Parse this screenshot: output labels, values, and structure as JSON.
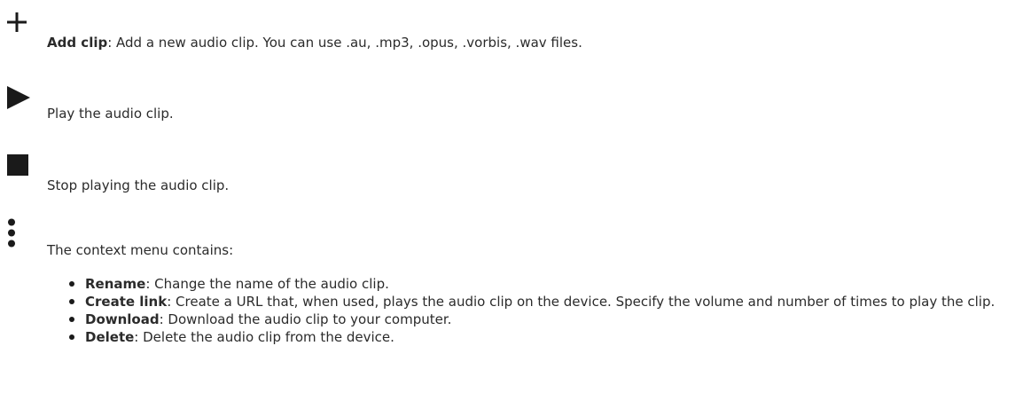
{
  "entries": [
    {
      "icon": "plus-icon",
      "term": "Add clip",
      "text": ": Add a new audio clip. You can use .au, .mp3, .opus, .vorbis, .wav files."
    },
    {
      "icon": "play-icon",
      "text": "Play the audio clip."
    },
    {
      "icon": "stop-icon",
      "text": "Stop playing the audio clip."
    },
    {
      "icon": "more-vertical-icon",
      "text": "The context menu contains:"
    }
  ],
  "context_menu": [
    {
      "term": "Rename",
      "text": ": Change the name of the audio clip."
    },
    {
      "term": "Create link",
      "text": ": Create a URL that, when used, plays the audio clip on the device. Specify the volume and number of times to play the clip."
    },
    {
      "term": "Download",
      "text": ": Download the audio clip to your computer."
    },
    {
      "term": "Delete",
      "text": ": Delete the audio clip from the device."
    }
  ]
}
